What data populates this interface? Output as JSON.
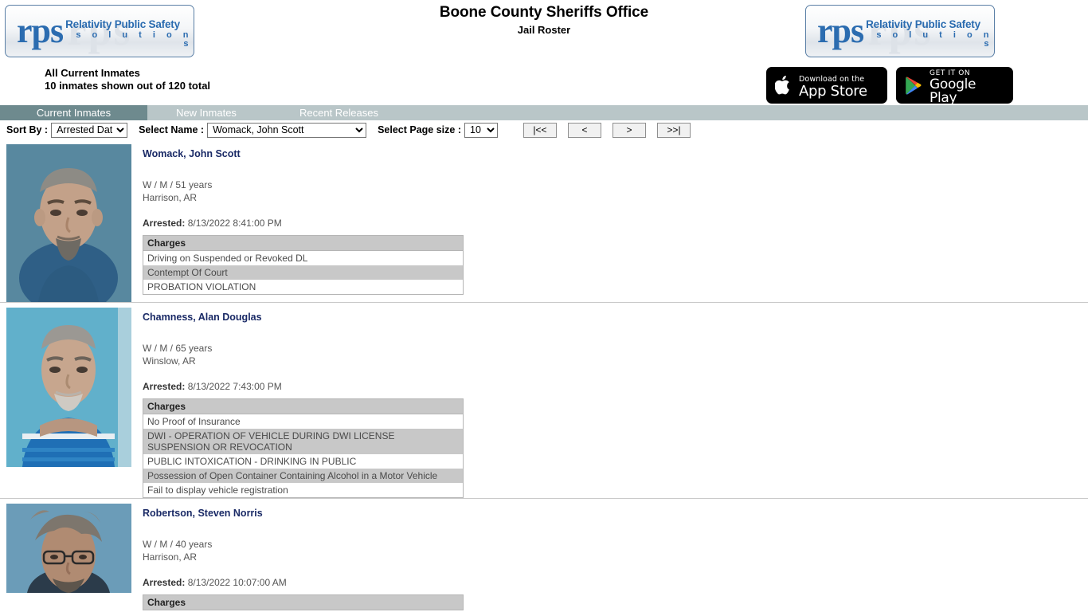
{
  "header": {
    "title": "Boone County Sheriffs Office",
    "subtitle": "Jail Roster",
    "summary_line1": "All Current Inmates",
    "summary_line2": "10 inmates shown out of 120 total",
    "logo": {
      "mark": "rps",
      "line1": "Relativity Public Safety",
      "line2": "s o l u t i o n s",
      "watermark": "rps"
    },
    "badges": [
      {
        "small": "Download on the",
        "large": "App Store",
        "icon": "apple-icon"
      },
      {
        "small": "GET IT ON",
        "large": "Google Play",
        "icon": "google-play-icon"
      }
    ]
  },
  "tabs": [
    {
      "label": "Current Inmates",
      "active": true
    },
    {
      "label": "New Inmates",
      "active": false
    },
    {
      "label": "Recent Releases",
      "active": false
    }
  ],
  "controls": {
    "sort_label": "Sort By :",
    "sort_value": "Arrested Date",
    "name_label": "Select Name :",
    "name_value": "Womack, John Scott",
    "pagesize_label": "Select Page size :",
    "pagesize_value": "10",
    "pager": [
      {
        "label": "|<<",
        "name": "first-page-button"
      },
      {
        "label": "<",
        "name": "prev-page-button"
      },
      {
        "label": ">",
        "name": "next-page-button"
      },
      {
        "label": ">>|",
        "name": "last-page-button"
      }
    ]
  },
  "charges_header": "Charges",
  "arrested_label": "Arrested:",
  "inmates": [
    {
      "name": "Womack, John Scott",
      "demographics": "W / M / 51 years",
      "city": "Harrison, AR",
      "arrested": "8/13/2022 8:41:00 PM",
      "charges": [
        "Driving on Suspended or Revoked DL",
        "Contempt Of Court",
        "PROBATION VIOLATION"
      ]
    },
    {
      "name": "Chamness, Alan Douglas",
      "demographics": "W / M / 65 years",
      "city": "Winslow, AR",
      "arrested": "8/13/2022 7:43:00 PM",
      "charges": [
        "No Proof of Insurance",
        "DWI - OPERATION OF VEHICLE DURING DWI LICENSE SUSPENSION OR REVOCATION",
        "PUBLIC INTOXICATION - DRINKING IN PUBLIC",
        "Possession of Open Container Containing Alcohol in a Motor Vehicle",
        "Fail to display vehicle registration"
      ]
    },
    {
      "name": "Robertson, Steven Norris",
      "demographics": "W / M / 40 years",
      "city": "Harrison, AR",
      "arrested": "8/13/2022 10:07:00 AM",
      "charges": []
    }
  ],
  "colors": {
    "tab_active": "#6e8a8e",
    "tab_inactive": "#b9c6c8",
    "name_link": "#1a2a66",
    "table_header": "#c8c8c8",
    "logo_blue": "#2b6cb0"
  }
}
